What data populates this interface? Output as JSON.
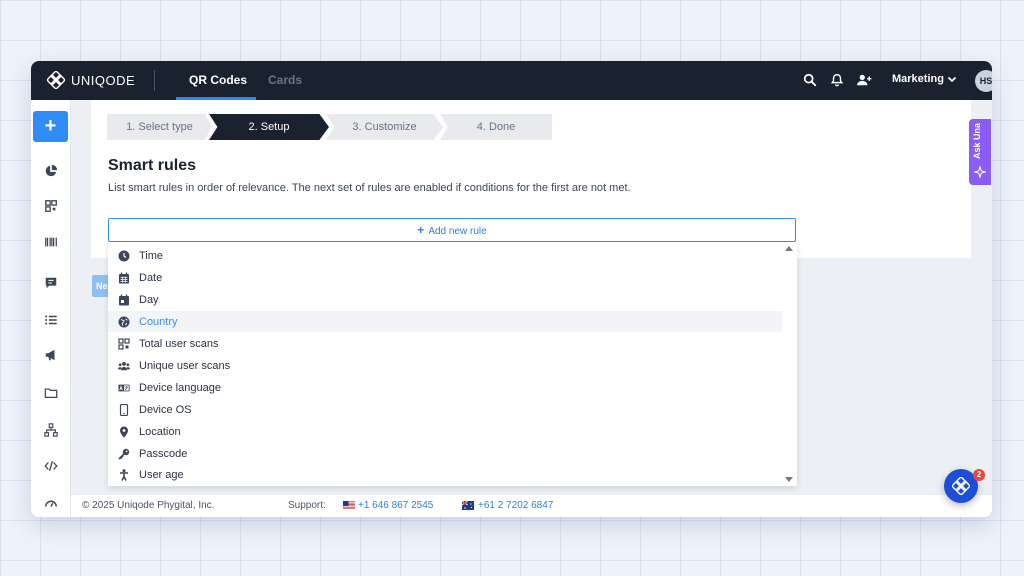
{
  "topbar": {
    "brand": "UNIQODE",
    "tabs": [
      {
        "label": "QR Codes",
        "active": true
      },
      {
        "label": "Cards",
        "active": false
      }
    ],
    "icons": [
      "search-icon",
      "bell-icon",
      "add-user-icon"
    ],
    "workspace_label": "Marketing",
    "avatar_initials": "HS"
  },
  "sidebar": {
    "create_label": "+",
    "icons": [
      "pie-chart-icon",
      "qr-grid-icon",
      "barcode-icon",
      "chat-icon",
      "list-icon",
      "megaphone-icon",
      "folder-icon",
      "sitemap-icon",
      "code-icon",
      "gauge-icon"
    ]
  },
  "steps": [
    {
      "label": "1. Select type",
      "state": "done"
    },
    {
      "label": "2. Setup",
      "state": "active"
    },
    {
      "label": "3. Customize",
      "state": "pending"
    },
    {
      "label": "4. Done",
      "state": "pending"
    }
  ],
  "page": {
    "title": "Smart rules",
    "description": "List smart rules in order of relevance. The next set of rules are enabled if conditions for the first are not met.",
    "add_rule_label": "Add new rule",
    "next_label": "Ne"
  },
  "dropdown": {
    "items": [
      {
        "label": "Time",
        "icon": "clock-icon"
      },
      {
        "label": "Date",
        "icon": "calendar-icon"
      },
      {
        "label": "Day",
        "icon": "calendar-day-icon"
      },
      {
        "label": "Country",
        "icon": "globe-icon",
        "selected": true
      },
      {
        "label": "Total user scans",
        "icon": "qr-grid-icon"
      },
      {
        "label": "Unique user scans",
        "icon": "users-icon"
      },
      {
        "label": "Device language",
        "icon": "language-icon"
      },
      {
        "label": "Device OS",
        "icon": "mobile-icon"
      },
      {
        "label": "Location",
        "icon": "location-pin-icon"
      },
      {
        "label": "Passcode",
        "icon": "key-icon"
      },
      {
        "label": "User age",
        "icon": "person-icon"
      }
    ]
  },
  "footer": {
    "copyright": "© 2025 Uniqode Phygital, Inc.",
    "support_label": "Support:",
    "phones": [
      {
        "flag": "us-flag-icon",
        "number": "+1 646 867 2545"
      },
      {
        "flag": "au-flag-icon",
        "number": "+61 2 7202 6847"
      }
    ]
  },
  "assistant": {
    "label": "Ask Una",
    "chat_badge": "2"
  },
  "colors": {
    "topbar": "#1a2230",
    "accent": "#2f8cf6",
    "assistant": "#8b5cf6",
    "badge": "#ef4444"
  }
}
